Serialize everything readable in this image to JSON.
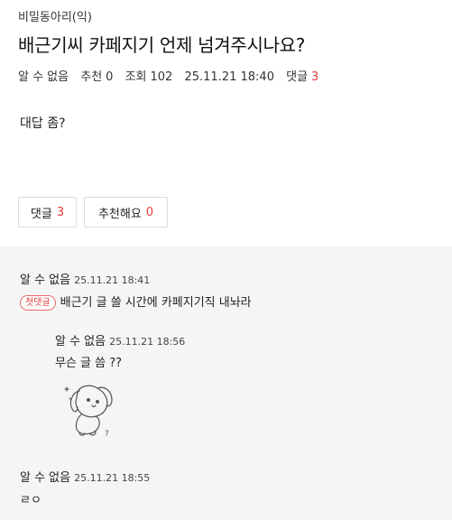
{
  "post": {
    "board": "비밀동아리(익)",
    "title": "배근기씨 카페지기 언제 넘겨주시나요?",
    "author": "알 수 없음",
    "recommend_label": "추천",
    "recommend_count": "0",
    "views_label": "조회",
    "views_count": "102",
    "date": "25.11.21 18:40",
    "comments_label": "댓글",
    "comments_count": "3",
    "body": "대답 좀?"
  },
  "actions": {
    "comment_button_label": "댓글",
    "comment_button_count": "3",
    "recommend_button_label": "추천해요",
    "recommend_button_count": "0"
  },
  "comments": [
    {
      "author": "알 수 없음",
      "time": "25.11.21 18:41",
      "badge": "첫댓글",
      "text": "배근기 글 쓸 시간에 카페지기직 내놔라"
    },
    {
      "author": "알 수 없음",
      "time": "25.11.21 18:56",
      "text": "무슨 글 씀 ??",
      "sticker": "puppy-sticker-icon",
      "sticker_mark": "?",
      "is_reply": true
    },
    {
      "author": "알 수 없음",
      "time": "25.11.21 18:55",
      "text": "ㄹㅇ"
    }
  ],
  "colors": {
    "accent_red": "#e63d3d",
    "comment_bg": "#f5f5f5",
    "border": "#dcdcdc"
  }
}
